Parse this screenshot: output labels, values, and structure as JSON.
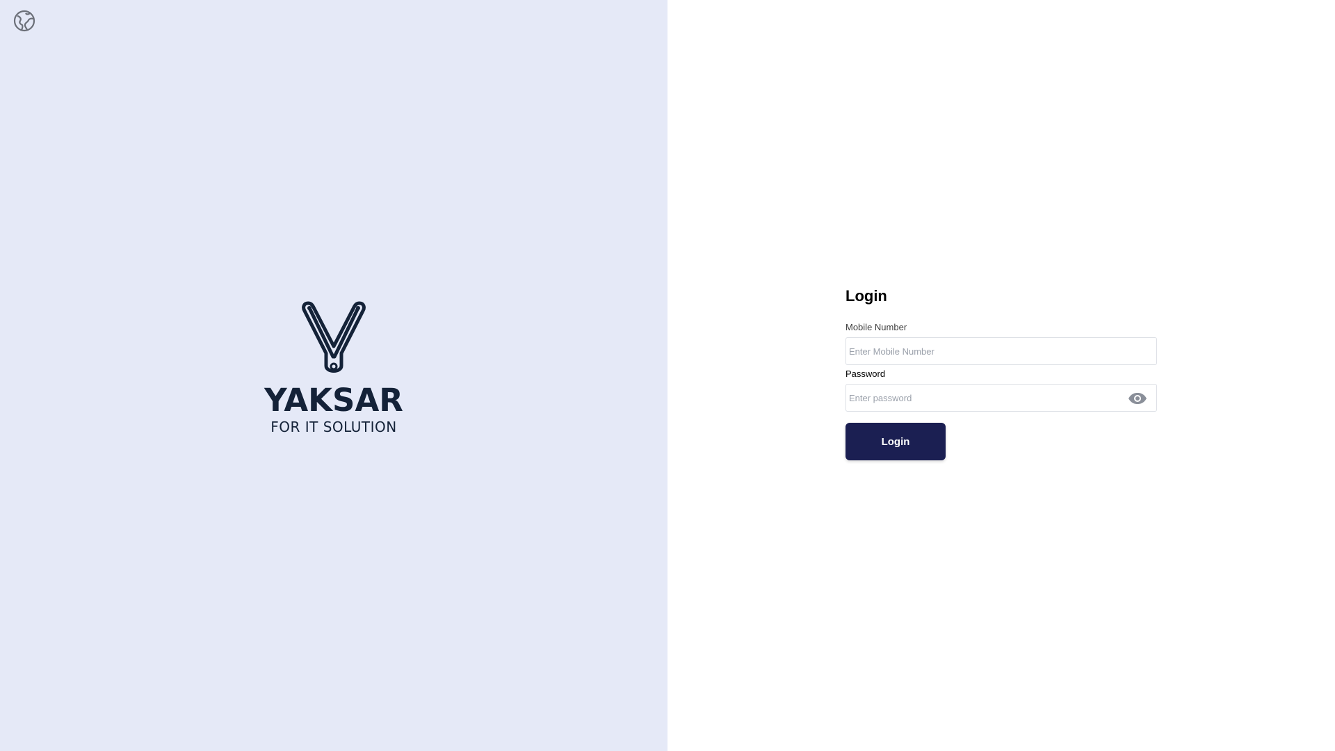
{
  "colors": {
    "left_panel_bg": "#e5e9f7",
    "brand_navy": "#142238",
    "button_bg": "#1b1f52",
    "button_text": "#ffffff",
    "input_border": "#dcdfe5",
    "placeholder": "#9aa0aa",
    "icon_gray": "#8a8f99"
  },
  "header": {
    "language_icon": "globe-icon"
  },
  "brand": {
    "logo_icon": "yaksar-y-logo",
    "name": "YAKSAR",
    "tagline": "FOR IT SOLUTION"
  },
  "login": {
    "title": "Login",
    "mobile": {
      "label": "Mobile Number",
      "placeholder": "Enter Mobile Number",
      "value": ""
    },
    "password": {
      "label": "Password",
      "placeholder": "Enter password",
      "value": "",
      "toggle_icon": "eye-icon"
    },
    "submit_label": "Login"
  }
}
